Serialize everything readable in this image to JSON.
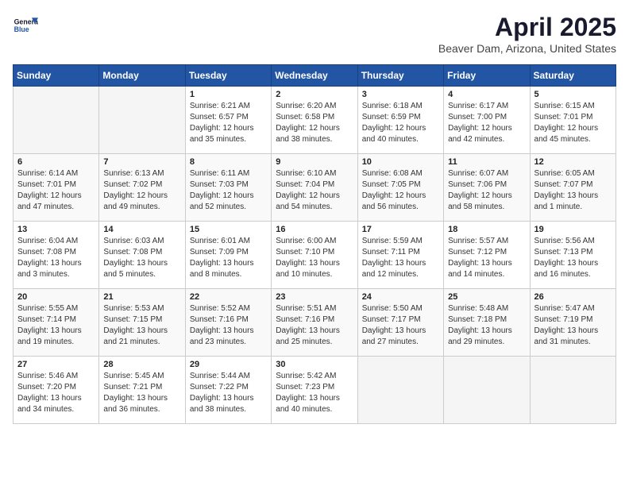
{
  "header": {
    "logo_line1": "General",
    "logo_line2": "Blue",
    "month_year": "April 2025",
    "location": "Beaver Dam, Arizona, United States"
  },
  "days_of_week": [
    "Sunday",
    "Monday",
    "Tuesday",
    "Wednesday",
    "Thursday",
    "Friday",
    "Saturday"
  ],
  "weeks": [
    [
      {
        "day": "",
        "info": ""
      },
      {
        "day": "",
        "info": ""
      },
      {
        "day": "1",
        "info": "Sunrise: 6:21 AM\nSunset: 6:57 PM\nDaylight: 12 hours and 35 minutes."
      },
      {
        "day": "2",
        "info": "Sunrise: 6:20 AM\nSunset: 6:58 PM\nDaylight: 12 hours and 38 minutes."
      },
      {
        "day": "3",
        "info": "Sunrise: 6:18 AM\nSunset: 6:59 PM\nDaylight: 12 hours and 40 minutes."
      },
      {
        "day": "4",
        "info": "Sunrise: 6:17 AM\nSunset: 7:00 PM\nDaylight: 12 hours and 42 minutes."
      },
      {
        "day": "5",
        "info": "Sunrise: 6:15 AM\nSunset: 7:01 PM\nDaylight: 12 hours and 45 minutes."
      }
    ],
    [
      {
        "day": "6",
        "info": "Sunrise: 6:14 AM\nSunset: 7:01 PM\nDaylight: 12 hours and 47 minutes."
      },
      {
        "day": "7",
        "info": "Sunrise: 6:13 AM\nSunset: 7:02 PM\nDaylight: 12 hours and 49 minutes."
      },
      {
        "day": "8",
        "info": "Sunrise: 6:11 AM\nSunset: 7:03 PM\nDaylight: 12 hours and 52 minutes."
      },
      {
        "day": "9",
        "info": "Sunrise: 6:10 AM\nSunset: 7:04 PM\nDaylight: 12 hours and 54 minutes."
      },
      {
        "day": "10",
        "info": "Sunrise: 6:08 AM\nSunset: 7:05 PM\nDaylight: 12 hours and 56 minutes."
      },
      {
        "day": "11",
        "info": "Sunrise: 6:07 AM\nSunset: 7:06 PM\nDaylight: 12 hours and 58 minutes."
      },
      {
        "day": "12",
        "info": "Sunrise: 6:05 AM\nSunset: 7:07 PM\nDaylight: 13 hours and 1 minute."
      }
    ],
    [
      {
        "day": "13",
        "info": "Sunrise: 6:04 AM\nSunset: 7:08 PM\nDaylight: 13 hours and 3 minutes."
      },
      {
        "day": "14",
        "info": "Sunrise: 6:03 AM\nSunset: 7:08 PM\nDaylight: 13 hours and 5 minutes."
      },
      {
        "day": "15",
        "info": "Sunrise: 6:01 AM\nSunset: 7:09 PM\nDaylight: 13 hours and 8 minutes."
      },
      {
        "day": "16",
        "info": "Sunrise: 6:00 AM\nSunset: 7:10 PM\nDaylight: 13 hours and 10 minutes."
      },
      {
        "day": "17",
        "info": "Sunrise: 5:59 AM\nSunset: 7:11 PM\nDaylight: 13 hours and 12 minutes."
      },
      {
        "day": "18",
        "info": "Sunrise: 5:57 AM\nSunset: 7:12 PM\nDaylight: 13 hours and 14 minutes."
      },
      {
        "day": "19",
        "info": "Sunrise: 5:56 AM\nSunset: 7:13 PM\nDaylight: 13 hours and 16 minutes."
      }
    ],
    [
      {
        "day": "20",
        "info": "Sunrise: 5:55 AM\nSunset: 7:14 PM\nDaylight: 13 hours and 19 minutes."
      },
      {
        "day": "21",
        "info": "Sunrise: 5:53 AM\nSunset: 7:15 PM\nDaylight: 13 hours and 21 minutes."
      },
      {
        "day": "22",
        "info": "Sunrise: 5:52 AM\nSunset: 7:16 PM\nDaylight: 13 hours and 23 minutes."
      },
      {
        "day": "23",
        "info": "Sunrise: 5:51 AM\nSunset: 7:16 PM\nDaylight: 13 hours and 25 minutes."
      },
      {
        "day": "24",
        "info": "Sunrise: 5:50 AM\nSunset: 7:17 PM\nDaylight: 13 hours and 27 minutes."
      },
      {
        "day": "25",
        "info": "Sunrise: 5:48 AM\nSunset: 7:18 PM\nDaylight: 13 hours and 29 minutes."
      },
      {
        "day": "26",
        "info": "Sunrise: 5:47 AM\nSunset: 7:19 PM\nDaylight: 13 hours and 31 minutes."
      }
    ],
    [
      {
        "day": "27",
        "info": "Sunrise: 5:46 AM\nSunset: 7:20 PM\nDaylight: 13 hours and 34 minutes."
      },
      {
        "day": "28",
        "info": "Sunrise: 5:45 AM\nSunset: 7:21 PM\nDaylight: 13 hours and 36 minutes."
      },
      {
        "day": "29",
        "info": "Sunrise: 5:44 AM\nSunset: 7:22 PM\nDaylight: 13 hours and 38 minutes."
      },
      {
        "day": "30",
        "info": "Sunrise: 5:42 AM\nSunset: 7:23 PM\nDaylight: 13 hours and 40 minutes."
      },
      {
        "day": "",
        "info": ""
      },
      {
        "day": "",
        "info": ""
      },
      {
        "day": "",
        "info": ""
      }
    ]
  ]
}
